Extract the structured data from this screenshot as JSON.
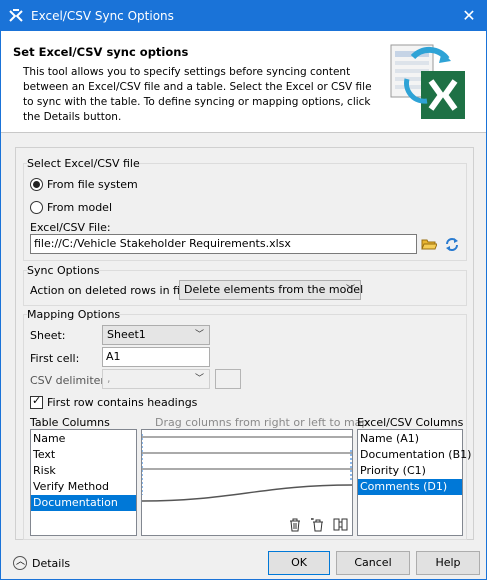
{
  "window": {
    "title": "Excel/CSV Sync Options",
    "close_glyph": "✕"
  },
  "header": {
    "title": "Set Excel/CSV sync options",
    "description": "This tool allows you to specify settings before syncing content between an Excel/CSV file and a table. Select the Excel or CSV file to sync with the table. To define syncing or mapping options, click the Details button."
  },
  "file_group": {
    "title": "Select Excel/CSV file",
    "radio_file_system": "From file system",
    "radio_model": "From model",
    "selected": "From file system",
    "file_label": "Excel/CSV File:",
    "file_value": "file://C:/Vehicle Stakeholder Requirements.xlsx"
  },
  "sync_group": {
    "title": "Sync Options",
    "deleted_rows_label": "Action on deleted rows in file:",
    "deleted_rows_value": "Delete elements from the model"
  },
  "mapping_group": {
    "title": "Mapping Options",
    "sheet_label": "Sheet:",
    "sheet_value": "Sheet1",
    "first_cell_label": "First cell:",
    "first_cell_value": "A1",
    "csv_delimiter_label": "CSV delimiter:",
    "csv_delimiter_value": ",",
    "first_row_headings_label": "First row contains headings",
    "first_row_headings_checked": true,
    "table_columns_label": "Table Columns",
    "drag_hint": "Drag columns from right or left to map",
    "excel_columns_label": "Excel/CSV Columns",
    "table_columns": [
      "Name",
      "Text",
      "Risk",
      "Verify Method",
      "Documentation"
    ],
    "table_columns_selected": "Documentation",
    "excel_columns": [
      "Name (A1)",
      "Documentation (B1)",
      "Priority (C1)",
      "Comments (D1)"
    ],
    "excel_columns_selected": "Comments (D1)"
  },
  "footer": {
    "details_label": "Details",
    "ok_label": "OK",
    "cancel_label": "Cancel",
    "help_label": "Help"
  },
  "colors": {
    "titlebar": "#1a73d8",
    "selection": "#0078d7",
    "excel_green": "#1e7145"
  }
}
